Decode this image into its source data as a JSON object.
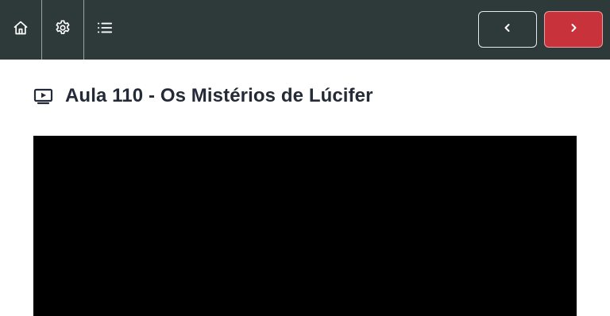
{
  "topbar": {
    "background": "#2e3a3a",
    "icons": {
      "home": "home-icon",
      "settings": "gear-icon",
      "list": "list-icon"
    },
    "prev_icon": "chevron-left-icon",
    "next_icon": "chevron-right-icon",
    "next_color": "#c8323a"
  },
  "lesson": {
    "icon": "video-lesson-icon",
    "title": "Aula 110 - Os Mistérios de Lúcifer"
  },
  "video": {
    "background": "#000000"
  }
}
